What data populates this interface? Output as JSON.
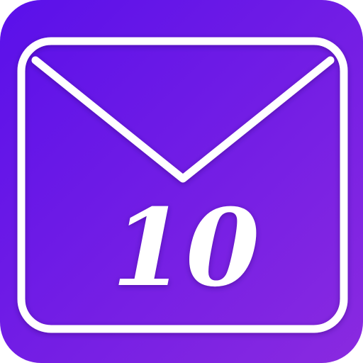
{
  "icon": {
    "name": "mail-icon",
    "count": "10",
    "colors": {
      "gradient_start": "#5a10ea",
      "gradient_end": "#8a2ae0",
      "stroke": "#ffffff",
      "text": "#ffffff"
    }
  }
}
